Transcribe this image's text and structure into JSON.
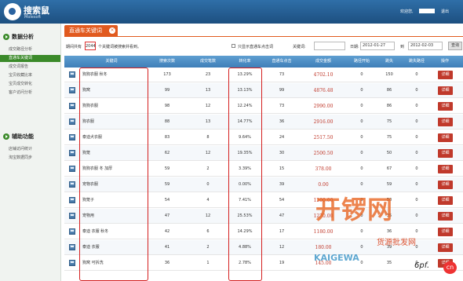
{
  "header": {
    "logo_name": "搜索鼠",
    "logo_sub": "Molesoft",
    "welcome": "欢迎您,",
    "logout": "退出",
    "user": ""
  },
  "sidebar": {
    "section1": "数据分析",
    "items": [
      {
        "label": "成交路径分析"
      },
      {
        "label": "直通车关键词"
      },
      {
        "label": "成交词报告"
      },
      {
        "label": "宝贝收藏比率"
      },
      {
        "label": "宝贝成交转化"
      },
      {
        "label": "客户访问分析"
      }
    ],
    "section2": "辅助功能",
    "items2": [
      {
        "label": "店铺访问统计"
      },
      {
        "label": "淘宝数据同步"
      }
    ]
  },
  "tab": {
    "title": "直通车关键词",
    "close": "×"
  },
  "filter": {
    "prefix": "期间共有",
    "count": "2044",
    "suffix": "个关键词被搜索并看到。",
    "checkbox_label": "只显示直通车点击词",
    "keyword_label": "关键词:",
    "date_label": "日期:",
    "date_from": "2012-01-27",
    "date_to_label": "到",
    "date_to": "2012-02-03",
    "search_button": "查询"
  },
  "table": {
    "headers": [
      "关键词",
      "搜索次数",
      "成交笔数",
      "转化率",
      "直通车点击",
      "成交金额",
      "路径开始",
      "跳失",
      "跳失路径",
      "操作"
    ],
    "detail_label": "详细",
    "rows": [
      {
        "kw": "狗狗衣服 秋冬",
        "searches": "173",
        "orders": "23",
        "rate": "13.29%",
        "clicks": "73",
        "amount": "4702.10",
        "start": "0",
        "bounce": "150",
        "bpath": "0"
      },
      {
        "kw": "狗窝",
        "searches": "99",
        "orders": "13",
        "rate": "13.13%",
        "clicks": "99",
        "amount": "4876.48",
        "start": "0",
        "bounce": "86",
        "bpath": "0"
      },
      {
        "kw": "狗狗衣服",
        "searches": "98",
        "orders": "12",
        "rate": "12.24%",
        "clicks": "73",
        "amount": "2990.00",
        "start": "0",
        "bounce": "86",
        "bpath": "0"
      },
      {
        "kw": "狗衣服",
        "searches": "88",
        "orders": "13",
        "rate": "14.77%",
        "clicks": "36",
        "amount": "2916.00",
        "start": "0",
        "bounce": "75",
        "bpath": "0"
      },
      {
        "kw": "泰迪犬衣服",
        "searches": "83",
        "orders": "8",
        "rate": "9.64%",
        "clicks": "24",
        "amount": "2517.50",
        "start": "0",
        "bounce": "75",
        "bpath": "0"
      },
      {
        "kw": "狗笼",
        "searches": "62",
        "orders": "12",
        "rate": "19.35%",
        "clicks": "30",
        "amount": "2500.50",
        "start": "0",
        "bounce": "50",
        "bpath": "0"
      },
      {
        "kw": "狗狗衣服 冬 加厚",
        "searches": "59",
        "orders": "2",
        "rate": "3.39%",
        "clicks": "15",
        "amount": "378.00",
        "start": "0",
        "bounce": "67",
        "bpath": "0"
      },
      {
        "kw": "宠物衣服",
        "searches": "59",
        "orders": "0",
        "rate": "0.00%",
        "clicks": "39",
        "amount": "0.00",
        "start": "0",
        "bounce": "59",
        "bpath": "0"
      },
      {
        "kw": "狗笼子",
        "searches": "54",
        "orders": "4",
        "rate": "7.41%",
        "clicks": "54",
        "amount": "1200.00",
        "start": "0",
        "bounce": "50",
        "bpath": "0"
      },
      {
        "kw": "宠物用",
        "searches": "47",
        "orders": "12",
        "rate": "25.53%",
        "clicks": "47",
        "amount": "1270.00",
        "start": "0",
        "bounce": "35",
        "bpath": "0"
      },
      {
        "kw": "泰迪 衣服 秋冬",
        "searches": "42",
        "orders": "6",
        "rate": "14.29%",
        "clicks": "17",
        "amount": "1180.00",
        "start": "0",
        "bounce": "36",
        "bpath": "0"
      },
      {
        "kw": "泰迪 衣服",
        "searches": "41",
        "orders": "2",
        "rate": "4.88%",
        "clicks": "12",
        "amount": "180.00",
        "start": "0",
        "bounce": "39",
        "bpath": "0"
      },
      {
        "kw": "狗窝 可拆洗",
        "searches": "36",
        "orders": "1",
        "rate": "2.78%",
        "clicks": "19",
        "amount": "145.00",
        "start": "0",
        "bounce": "35",
        "bpath": "0"
      }
    ]
  },
  "watermark": {
    "brand": "开锣网",
    "sub": "货源批发网",
    "url": "KAIGEWA",
    "url2": "6pf.",
    "cn": "cn"
  }
}
